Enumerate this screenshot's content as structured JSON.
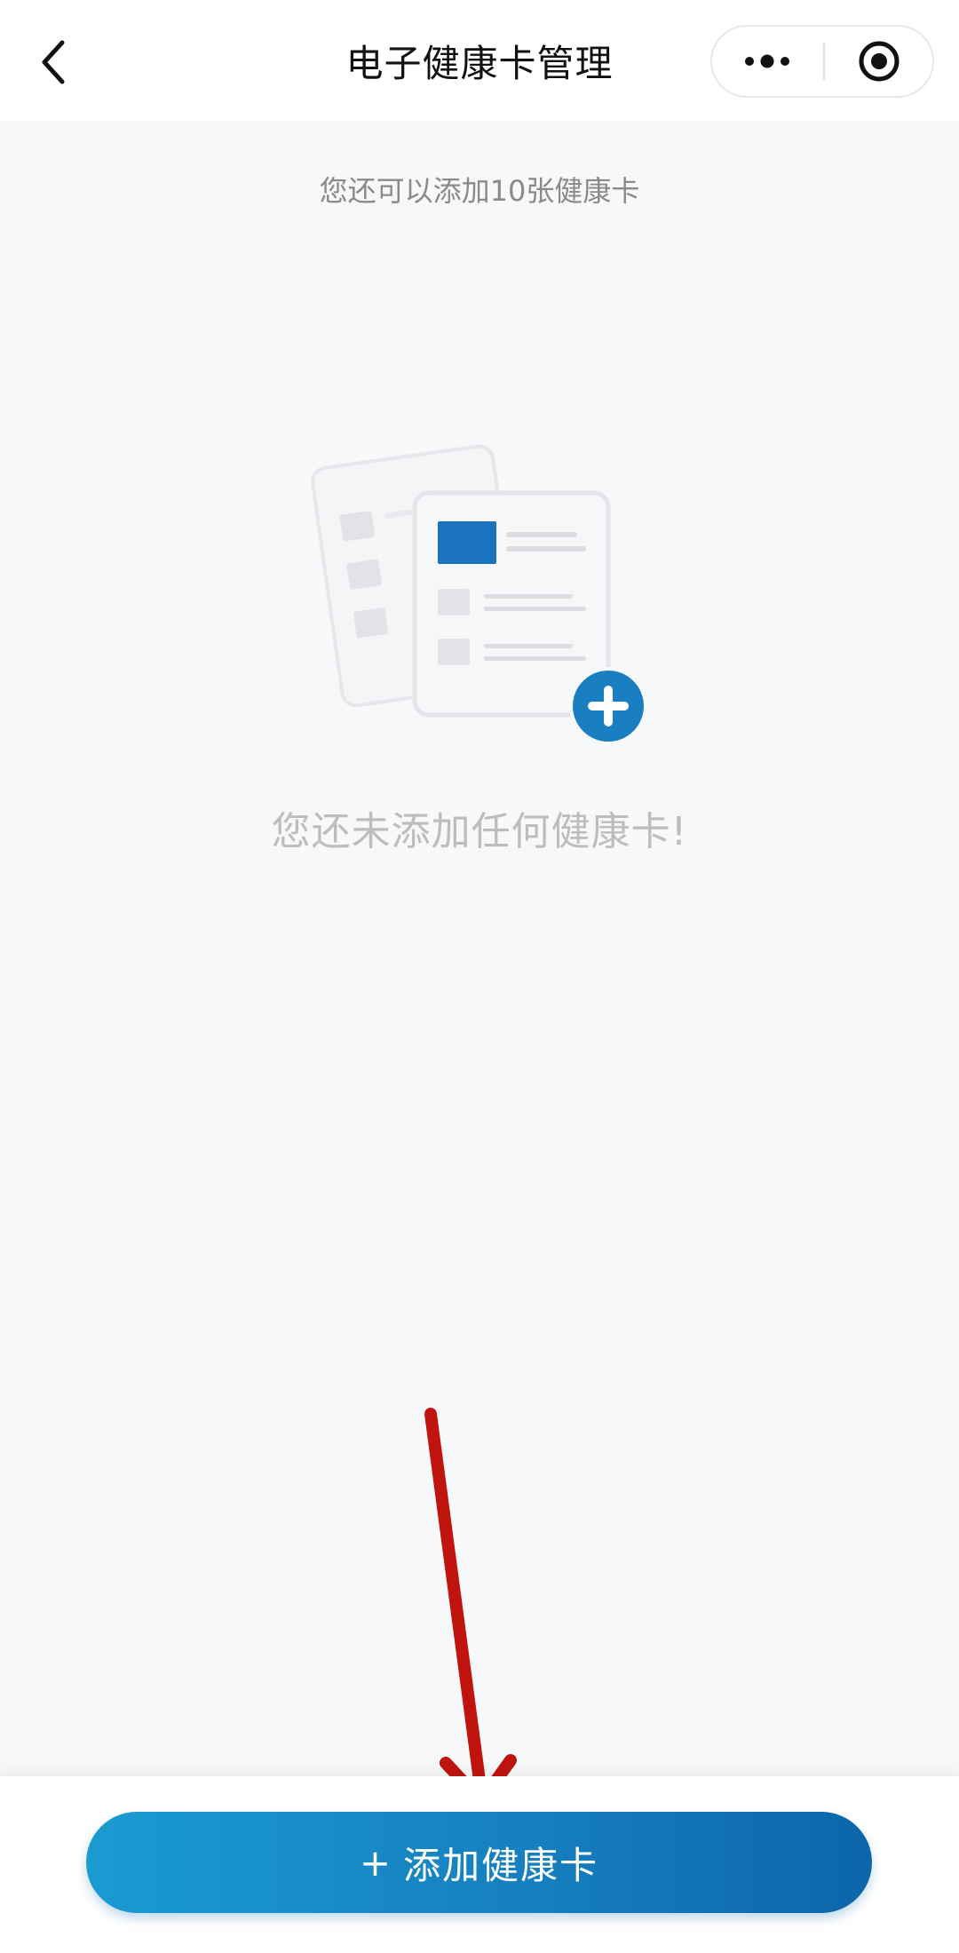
{
  "navbar": {
    "title": "电子健康卡管理",
    "back_icon": "chevron-left-icon",
    "more_icon": "more-dots-icon",
    "close_icon": "target-circle-icon"
  },
  "main": {
    "hint": "您还可以添加10张健康卡",
    "empty_text": "您还未添加任何健康卡!",
    "illustration_icon": "empty-cards-icon"
  },
  "bottom": {
    "add_button_plus": "+",
    "add_button_label": "添加健康卡"
  },
  "colors": {
    "accent": "#1a7fc1",
    "button_start": "#1a9bd1",
    "button_end": "#0b66aa",
    "annotation_arrow": "#c0150f",
    "background": "#f7f8fa"
  }
}
